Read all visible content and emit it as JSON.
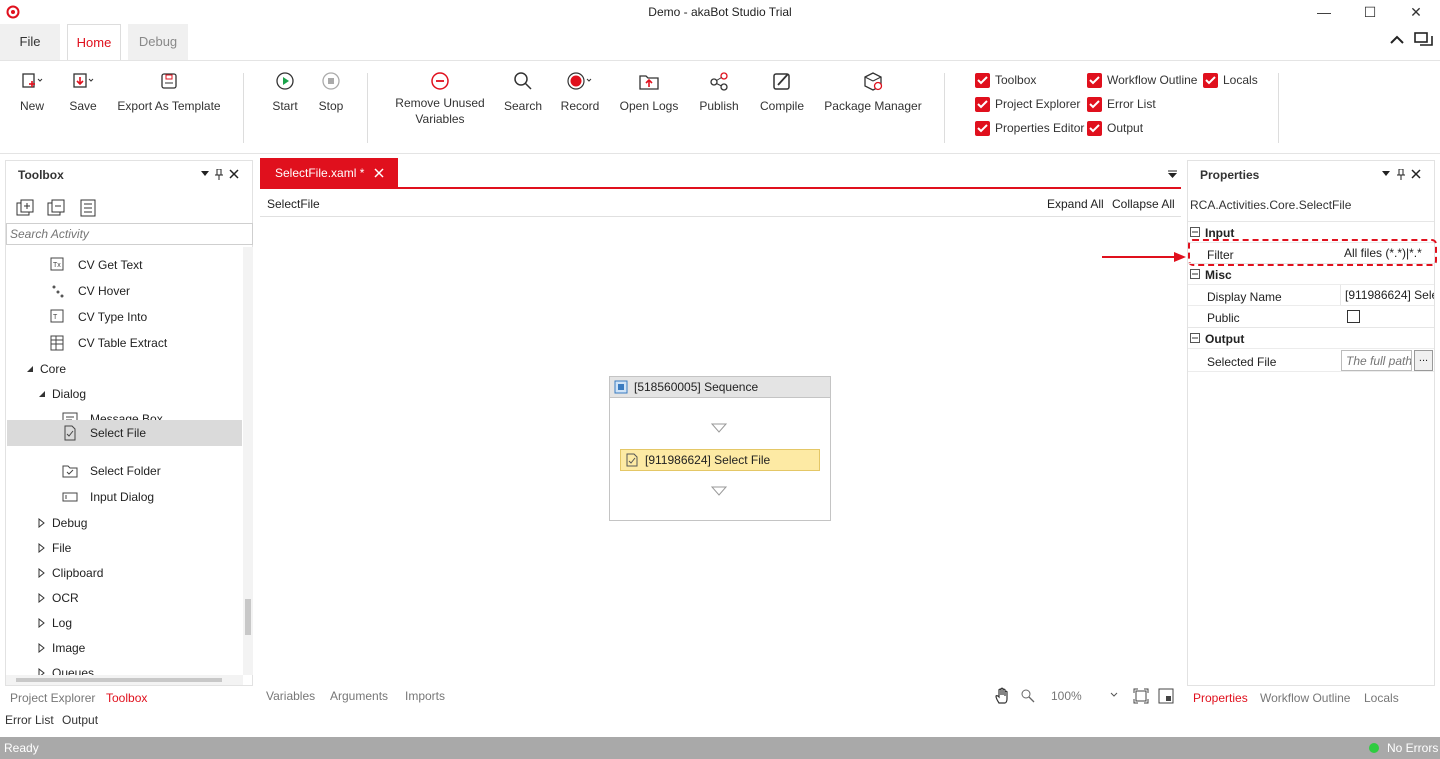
{
  "window": {
    "title": "Demo - akaBot Studio Trial",
    "minimize": "—",
    "maximize": "☐",
    "close": "✕"
  },
  "menu_tabs": [
    {
      "label": "File"
    },
    {
      "label": "Home"
    },
    {
      "label": "Debug"
    }
  ],
  "ribbon": {
    "buttons": [
      {
        "label": "New",
        "icon": "new-file-icon"
      },
      {
        "label": "Save",
        "icon": "save-icon"
      },
      {
        "label": "Export As Template",
        "icon": "export-template-icon"
      },
      {
        "label": "Start",
        "icon": "play-icon"
      },
      {
        "label": "Stop",
        "icon": "stop-icon"
      },
      {
        "label": "Remove Unused Variables",
        "icon": "remove-icon"
      },
      {
        "label": "Search",
        "icon": "search-icon"
      },
      {
        "label": "Record",
        "icon": "record-icon"
      },
      {
        "label": "Open Logs",
        "icon": "folder-icon"
      },
      {
        "label": "Publish",
        "icon": "share-icon"
      },
      {
        "label": "Compile",
        "icon": "compile-icon"
      },
      {
        "label": "Package Manager",
        "icon": "package-icon"
      }
    ],
    "checkboxes": [
      {
        "label": "Toolbox",
        "checked": true
      },
      {
        "label": "Workflow Outline",
        "checked": true
      },
      {
        "label": "Locals",
        "checked": true
      },
      {
        "label": "Project Explorer",
        "checked": true
      },
      {
        "label": "Error List",
        "checked": true
      },
      {
        "label": "Properties Editor",
        "checked": true
      },
      {
        "label": "Output",
        "checked": true
      }
    ]
  },
  "toolbox": {
    "title": "Toolbox",
    "search_placeholder": "Search Activity",
    "items": [
      {
        "label": "CV Get Text"
      },
      {
        "label": "CV Hover"
      },
      {
        "label": "CV Type Into"
      },
      {
        "label": "CV Table Extract"
      },
      {
        "label": "Core"
      },
      {
        "label": "Dialog"
      },
      {
        "label": "Message Box"
      },
      {
        "label": "Select File"
      },
      {
        "label": "Select Folder"
      },
      {
        "label": "Input Dialog"
      },
      {
        "label": "Debug"
      },
      {
        "label": "File"
      },
      {
        "label": "Clipboard"
      },
      {
        "label": "OCR"
      },
      {
        "label": "Log"
      },
      {
        "label": "Image"
      },
      {
        "label": "Queues"
      }
    ],
    "bottom_tabs": [
      {
        "label": "Project Explorer"
      },
      {
        "label": "Toolbox"
      }
    ]
  },
  "designer": {
    "tab_label": "SelectFile.xaml *",
    "breadcrumb": "SelectFile",
    "expand_all": "Expand All",
    "collapse_all": "Collapse All",
    "sequence_title": "[518560005] Sequence",
    "activity_title": "[911986624] Select File",
    "bottom_tabs": [
      {
        "label": "Variables"
      },
      {
        "label": "Arguments"
      },
      {
        "label": "Imports"
      }
    ],
    "zoom": "100%"
  },
  "properties": {
    "title": "Properties",
    "class_name": "RCA.Activities.Core.SelectFile",
    "sections": {
      "input": "Input",
      "misc": "Misc",
      "output": "Output"
    },
    "filter_label": "Filter",
    "filter_value": "All files (*.*)|*.*",
    "display_name_label": "Display Name",
    "display_name_value": "[911986624] Sele",
    "public_label": "Public",
    "public_checked": false,
    "selected_file_label": "Selected File",
    "selected_file_placeholder": "The full path",
    "ellipsis": "...",
    "bottom_tabs": [
      {
        "label": "Properties"
      },
      {
        "label": "Workflow Outline"
      },
      {
        "label": "Locals"
      }
    ]
  },
  "bottom_panel_tabs": [
    {
      "label": "Error List"
    },
    {
      "label": "Output"
    }
  ],
  "status": {
    "left": "Ready",
    "right": "No Errors"
  },
  "colors": {
    "accent": "#e0101d",
    "highlight": "#fdeaa4",
    "selected_row": "#dadada"
  }
}
